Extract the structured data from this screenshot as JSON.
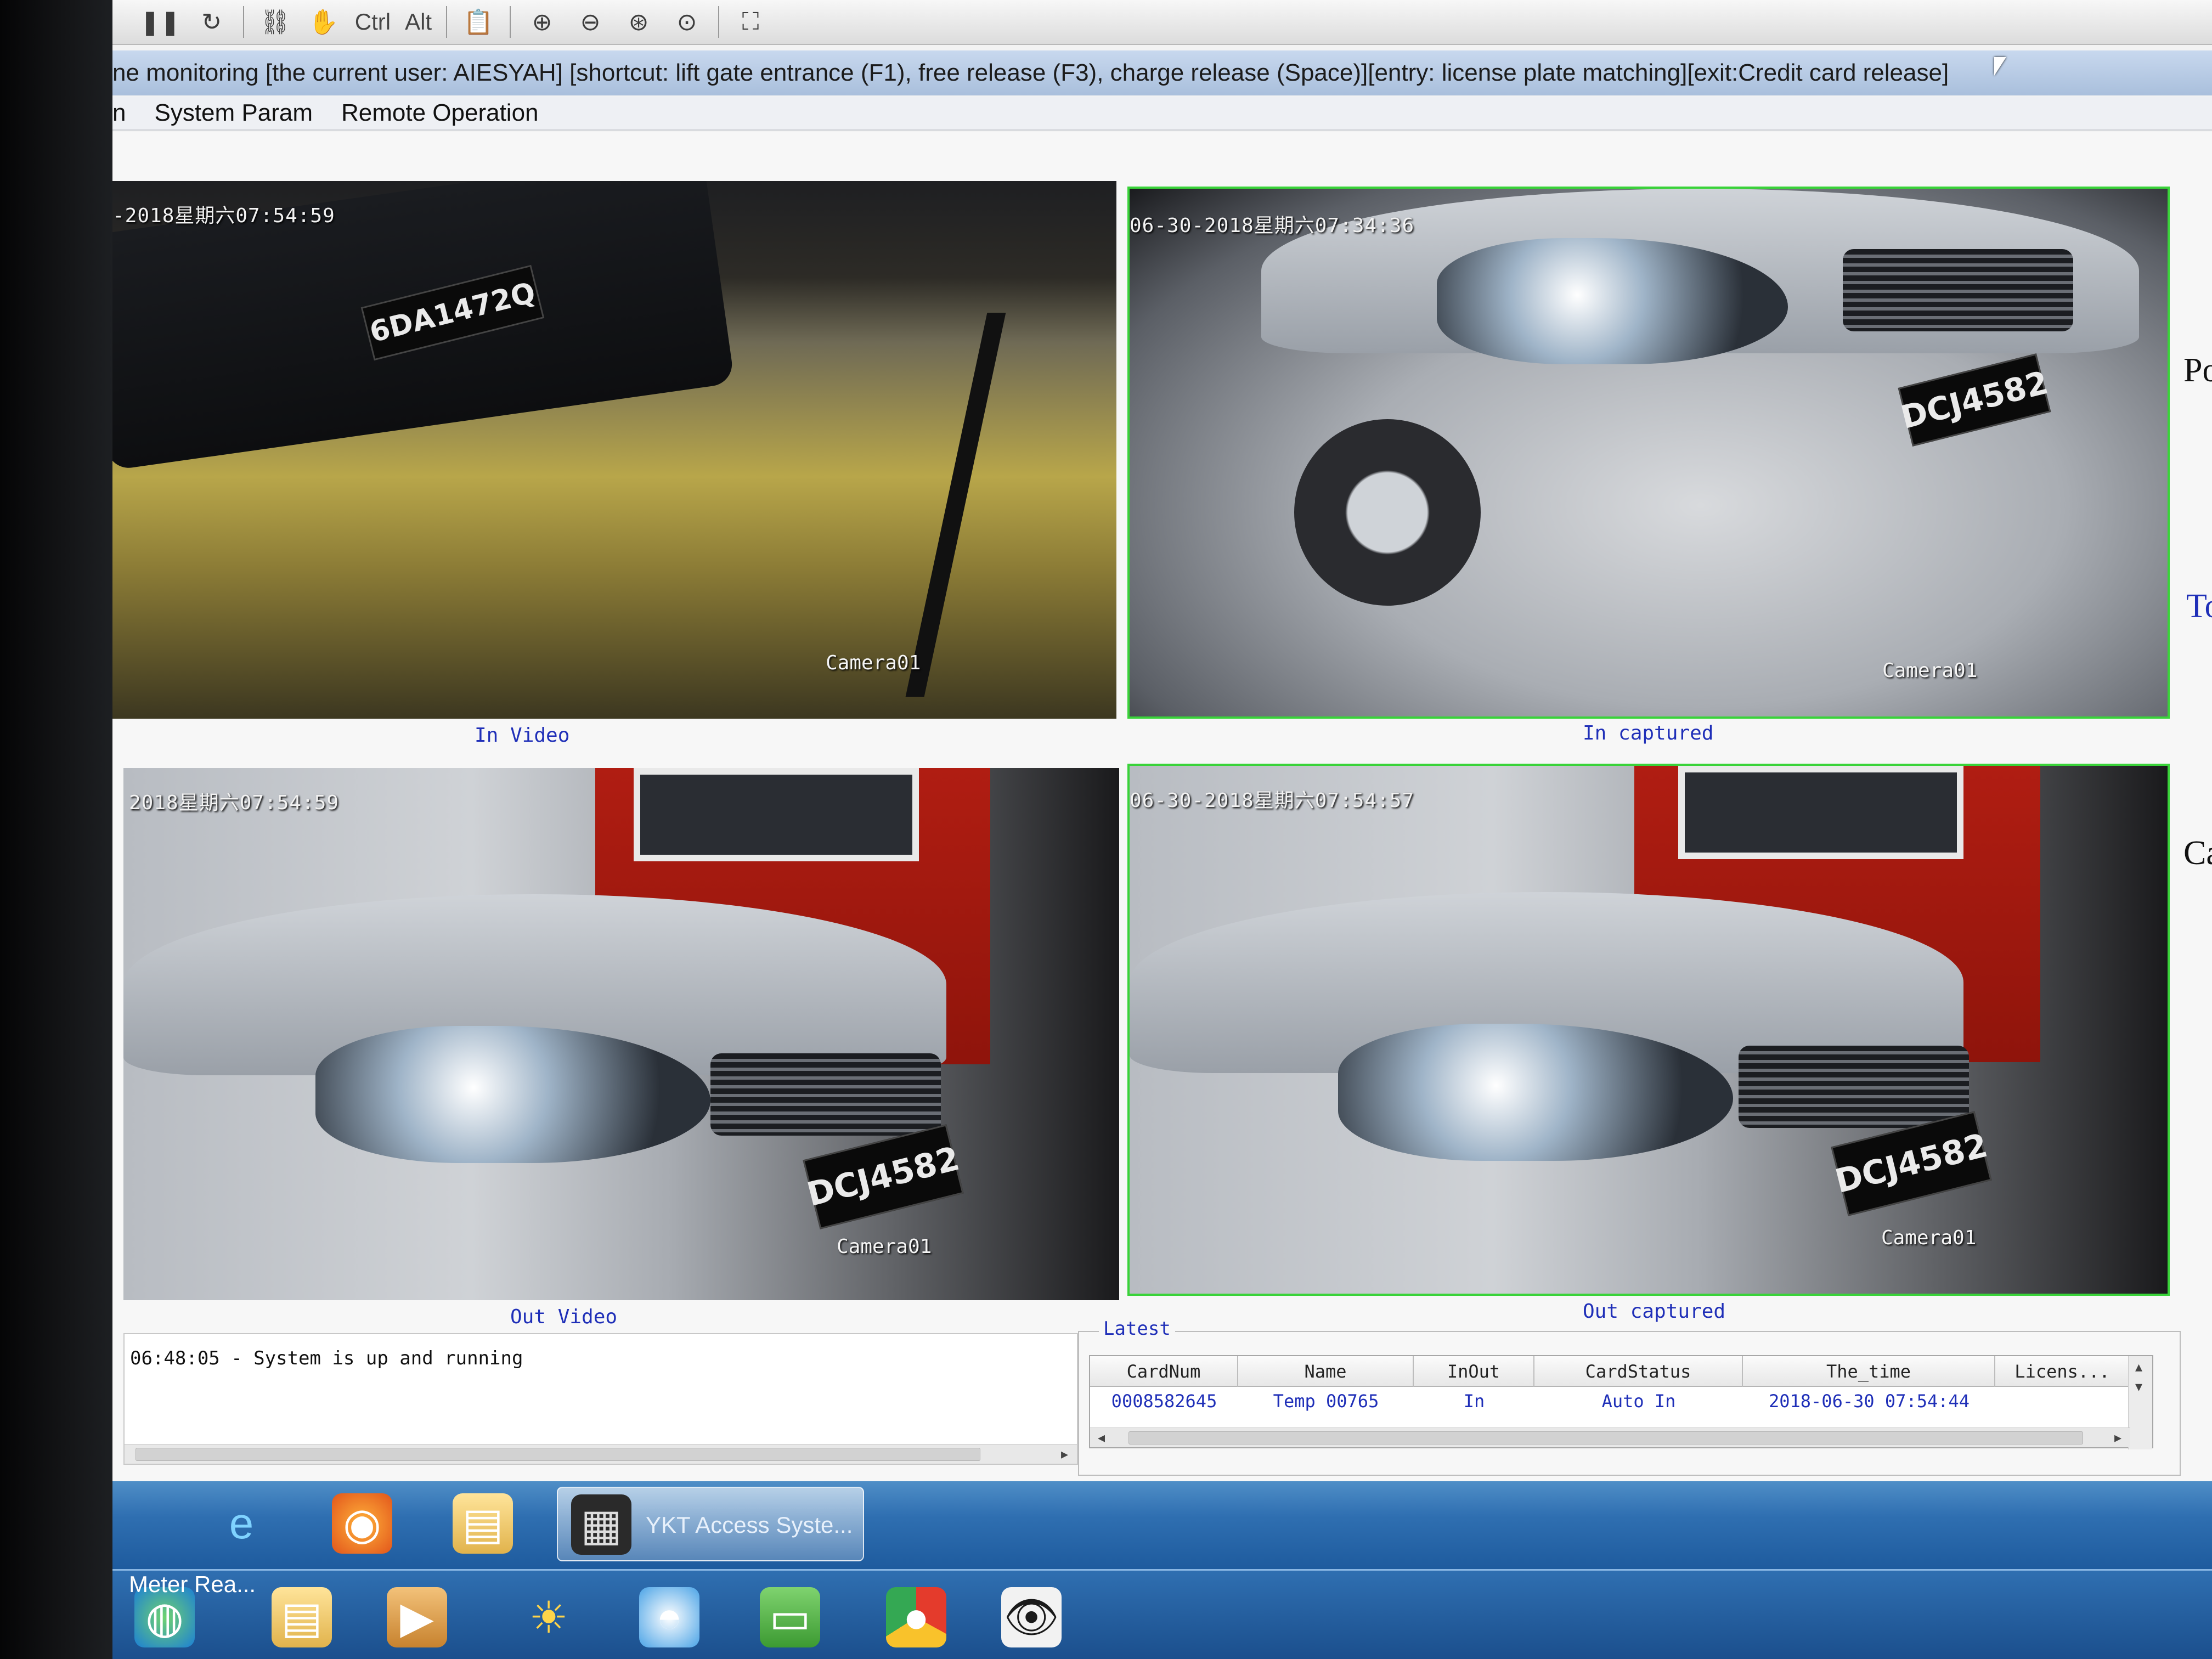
{
  "toolbar": {
    "ctrl_label": "Ctrl",
    "alt_label": "Alt"
  },
  "titlebar": {
    "text": "ne monitoring [the current user: AIESYAH] [shortcut: lift gate entrance (F1), free release (F3), charge release (Space)][entry: license plate matching][exit:Credit card release]"
  },
  "menubar": {
    "items": [
      "n",
      "System Param",
      "Remote Operation"
    ]
  },
  "panels": {
    "in_video": {
      "caption": "In Video",
      "timestamp": "-2018星期六07:54:59",
      "camera": "Camera01",
      "plate": "6DA1472Q"
    },
    "in_captured": {
      "caption": "In captured",
      "timestamp": "06-30-2018星期六07:34:36",
      "camera": "Camera01",
      "plate": "DCJ4582"
    },
    "out_video": {
      "caption": "Out Video",
      "timestamp": "2018星期六07:54:59",
      "camera": "Camera01",
      "plate": "DCJ4582"
    },
    "out_captured": {
      "caption": "Out captured",
      "timestamp": "06-30-2018星期六07:54:57",
      "camera": "Camera01",
      "plate": "DCJ4582"
    }
  },
  "log": {
    "line": "06:48:05 - System is up and running"
  },
  "latest": {
    "legend": "Latest",
    "columns": [
      "CardNum",
      "Name",
      "InOut",
      "CardStatus",
      "The_time",
      "Licens..."
    ],
    "rows": [
      [
        "0008582645",
        "Temp 00765",
        "In",
        "Auto In",
        "2018-06-30 07:54:44",
        ""
      ]
    ]
  },
  "side_labels": [
    "Po",
    "To",
    "Ca"
  ],
  "taskbar": {
    "active_task": "YKT Access Syste...",
    "meter": "Meter Rea..."
  },
  "colors": {
    "caption_blue": "#1f2fb8",
    "capture_border": "#39d339",
    "taskbar_blue": "#2f6fb1"
  }
}
